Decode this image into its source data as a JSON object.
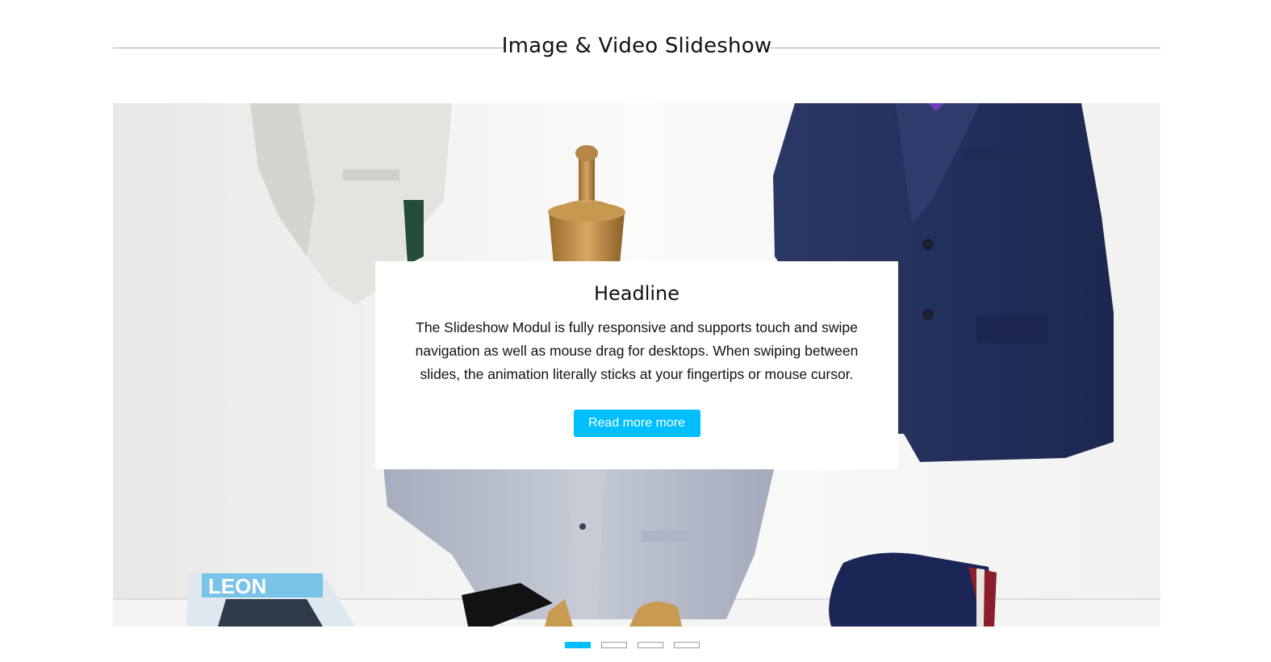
{
  "section": {
    "title": "Image & Video Slideshow"
  },
  "slideshow": {
    "slide_count": 4,
    "active_index": 0,
    "caption": {
      "headline": "Headline",
      "text": "The Slideshow Modul is fully responsive and supports touch and swipe navigation as well as mouse drag for desktops. When swiping between slides, the animation literally sticks at your fingertips or mouse cursor.",
      "button_label": "Read more more"
    },
    "magazine_logo": "LEON"
  },
  "colors": {
    "accent": "#00bfff",
    "jacket_navy": "#26325e",
    "blazer_grey": "#b7bccb",
    "mannequin_wood": "#c89a52"
  }
}
